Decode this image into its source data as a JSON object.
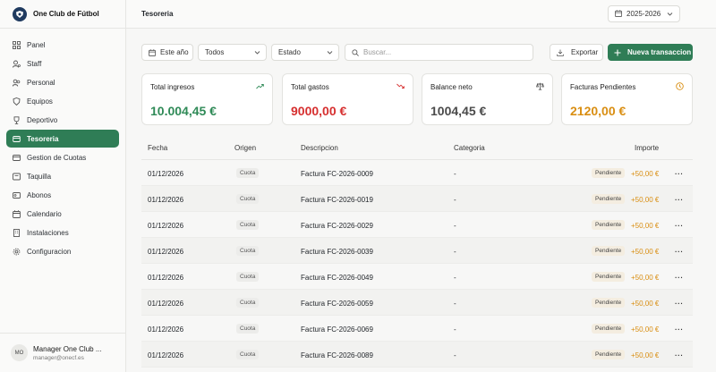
{
  "app": {
    "name": "One Club de Fútbol"
  },
  "sidebar": {
    "items": [
      {
        "label": "Panel",
        "icon": "dashboard-icon"
      },
      {
        "label": "Staff",
        "icon": "user-cog-icon"
      },
      {
        "label": "Personal",
        "icon": "users-icon"
      },
      {
        "label": "Equipos",
        "icon": "shield-icon"
      },
      {
        "label": "Deportivo",
        "icon": "trophy-icon"
      },
      {
        "label": "Tesoreria",
        "icon": "wallet-icon",
        "active": true
      },
      {
        "label": "Gestion de Cuotas",
        "icon": "card-icon"
      },
      {
        "label": "Taquilla",
        "icon": "ticket-icon"
      },
      {
        "label": "Abonos",
        "icon": "pass-icon"
      },
      {
        "label": "Calendario",
        "icon": "calendar-icon"
      },
      {
        "label": "Instalaciones",
        "icon": "building-icon"
      },
      {
        "label": "Configuracion",
        "icon": "gear-icon"
      }
    ]
  },
  "user": {
    "initials": "MO",
    "name": "Manager One Club ...",
    "email": "manager@onecf.es"
  },
  "header": {
    "title": "Tesoreria",
    "season": "2025-2026"
  },
  "filters": {
    "period": "Este año",
    "type": "Todos",
    "status": "Estado",
    "search_placeholder": "Buscar...",
    "export_label": "Exportar",
    "new_label": "Nueva transaccion"
  },
  "cards": [
    {
      "label": "Total ingresos",
      "value": "10.004,45 €",
      "color": "#2f8a57",
      "icon": "trend-up-icon"
    },
    {
      "label": "Total gastos",
      "value": "9000,00 €",
      "color": "#d62f2f",
      "icon": "trend-down-icon"
    },
    {
      "label": "Balance neto",
      "value": "1004,45 €",
      "color": "#4a4a4a",
      "icon": "scale-icon"
    },
    {
      "label": "Facturas Pendientes",
      "value": "2120,00 €",
      "color": "#d98e12",
      "icon": "clock-icon"
    }
  ],
  "table": {
    "columns": [
      "Fecha",
      "Origen",
      "Descripcion",
      "Categoria",
      "Importe"
    ],
    "rows": [
      {
        "fecha": "01/12/2026",
        "origen": "Cuota",
        "descripcion": "Factura FC-2026-0009",
        "categoria": "-",
        "estado": "Pendiente",
        "importe": "+50,00 €"
      },
      {
        "fecha": "01/12/2026",
        "origen": "Cuota",
        "descripcion": "Factura FC-2026-0019",
        "categoria": "-",
        "estado": "Pendiente",
        "importe": "+50,00 €"
      },
      {
        "fecha": "01/12/2026",
        "origen": "Cuota",
        "descripcion": "Factura FC-2026-0029",
        "categoria": "-",
        "estado": "Pendiente",
        "importe": "+50,00 €"
      },
      {
        "fecha": "01/12/2026",
        "origen": "Cuota",
        "descripcion": "Factura FC-2026-0039",
        "categoria": "-",
        "estado": "Pendiente",
        "importe": "+50,00 €"
      },
      {
        "fecha": "01/12/2026",
        "origen": "Cuota",
        "descripcion": "Factura FC-2026-0049",
        "categoria": "-",
        "estado": "Pendiente",
        "importe": "+50,00 €"
      },
      {
        "fecha": "01/12/2026",
        "origen": "Cuota",
        "descripcion": "Factura FC-2026-0059",
        "categoria": "-",
        "estado": "Pendiente",
        "importe": "+50,00 €"
      },
      {
        "fecha": "01/12/2026",
        "origen": "Cuota",
        "descripcion": "Factura FC-2026-0069",
        "categoria": "-",
        "estado": "Pendiente",
        "importe": "+50,00 €"
      },
      {
        "fecha": "01/12/2026",
        "origen": "Cuota",
        "descripcion": "Factura FC-2026-0089",
        "categoria": "-",
        "estado": "Pendiente",
        "importe": "+50,00 €"
      }
    ]
  }
}
